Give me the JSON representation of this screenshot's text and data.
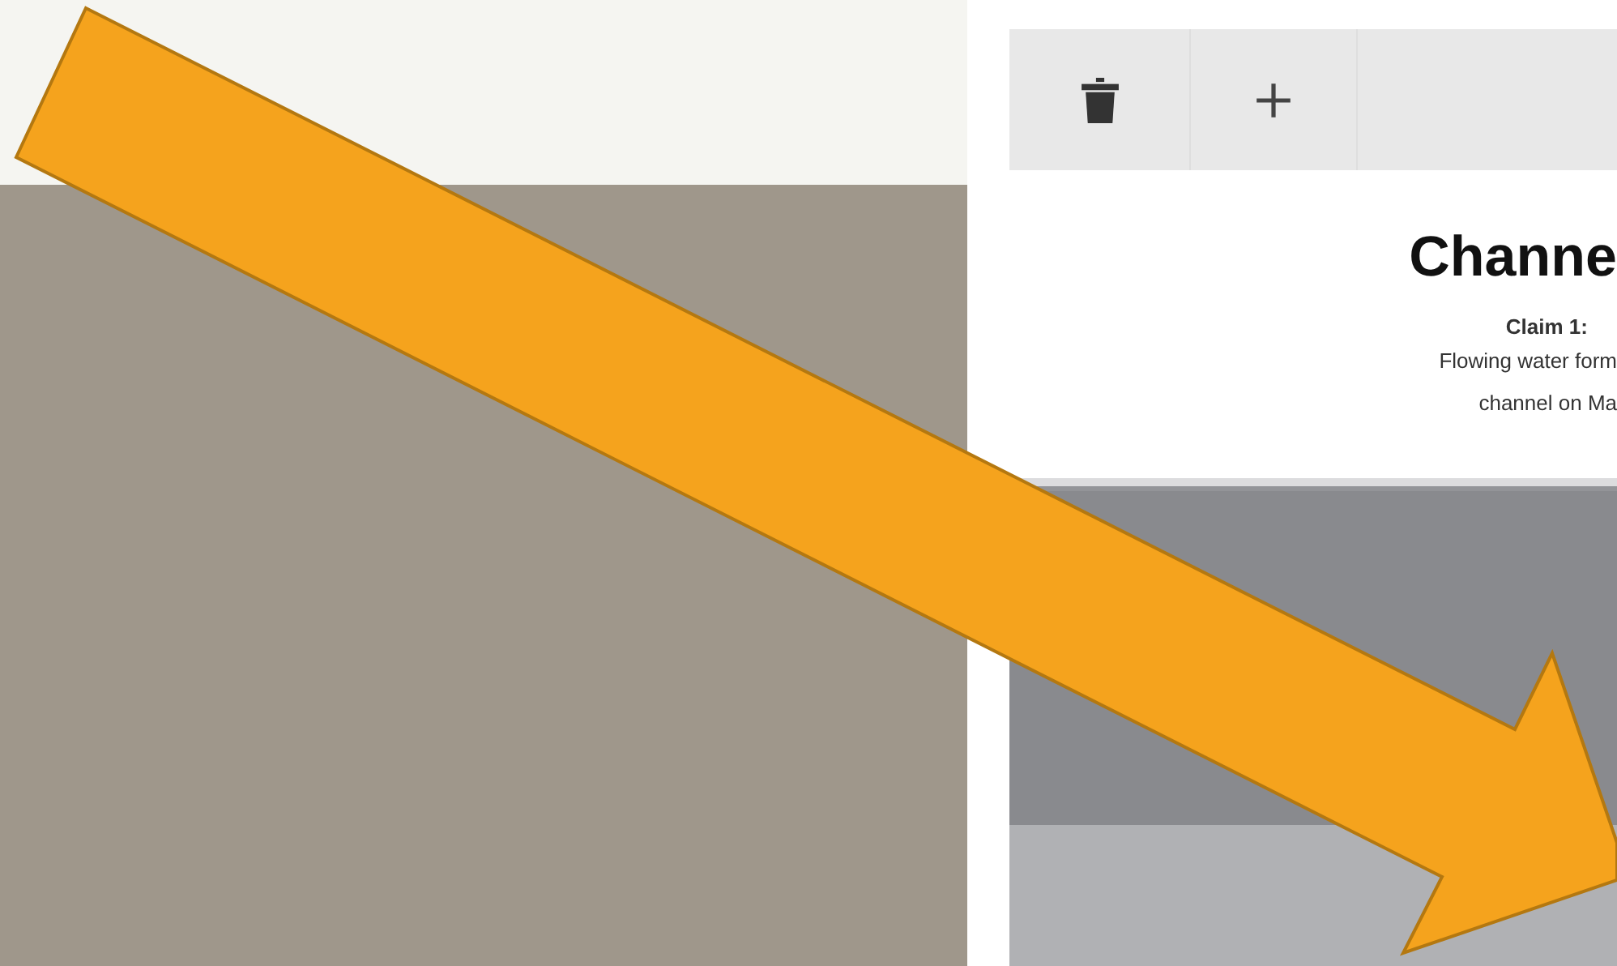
{
  "toolbar": {
    "buttons": [
      {
        "kind": "delete"
      },
      {
        "kind": "add"
      }
    ]
  },
  "card": {
    "title": "Channe",
    "claim_label": "Claim 1:",
    "claim_lines": [
      "Flowing water form",
      "channel on Ma"
    ]
  }
}
